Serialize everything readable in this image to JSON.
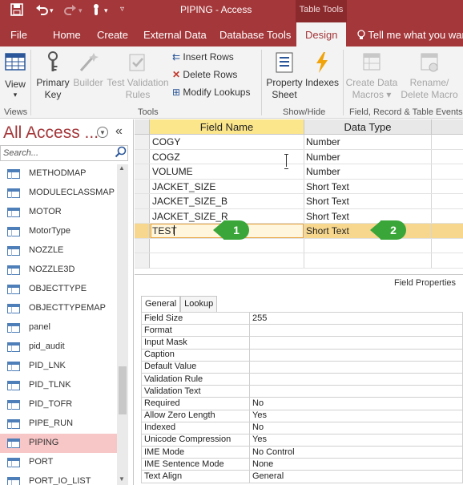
{
  "titlebar": {
    "title": "PIPING  -  Access",
    "contextual_tab_group": "Table Tools",
    "save_icon": "save-icon",
    "undo_icon": "undo-icon",
    "redo_icon": "redo-icon",
    "touch_icon": "touch-mode-icon",
    "customize_icon": "customize-qat-icon"
  },
  "tabs": [
    {
      "label": "File"
    },
    {
      "label": "Home"
    },
    {
      "label": "Create"
    },
    {
      "label": "External Data"
    },
    {
      "label": "Database Tools"
    },
    {
      "label": "Design"
    }
  ],
  "tellme": "Tell me what you want",
  "ribbon": {
    "view": {
      "label": "View",
      "arrow": "▾"
    },
    "primary_key": {
      "label1": "Primary",
      "label2": "Key"
    },
    "builder": {
      "label": "Builder"
    },
    "test_validation": {
      "label1": "Test Validation",
      "label2": "Rules"
    },
    "insert_rows": "Insert Rows",
    "delete_rows": "Delete Rows",
    "modify_lookups": "Modify Lookups",
    "property_sheet": {
      "label1": "Property",
      "label2": "Sheet"
    },
    "indexes": {
      "label": "Indexes"
    },
    "create_data_macros": {
      "label1": "Create Data",
      "label2": "Macros ▾"
    },
    "rename_delete_macro": {
      "label1": "Rename/",
      "label2": "Delete Macro"
    },
    "groups": [
      "Views",
      "Tools",
      "Show/Hide",
      "Field, Record & Table Events"
    ]
  },
  "nav": {
    "title": "All Access ...",
    "collapse": "«",
    "search_placeholder": "Search...",
    "items": [
      {
        "label": "METHODMAP"
      },
      {
        "label": "MODULECLASSMAP"
      },
      {
        "label": "MOTOR"
      },
      {
        "label": "MotorType"
      },
      {
        "label": "NOZZLE"
      },
      {
        "label": "NOZZLE3D"
      },
      {
        "label": "OBJECTTYPE"
      },
      {
        "label": "OBJECTTYPEMAP"
      },
      {
        "label": "panel"
      },
      {
        "label": "pid_audit"
      },
      {
        "label": "PID_LNK"
      },
      {
        "label": "PID_TLNK"
      },
      {
        "label": "PID_TOFR"
      },
      {
        "label": "PIPE_RUN"
      },
      {
        "label": "PIPING"
      },
      {
        "label": "PORT"
      },
      {
        "label": "PORT_IO_LIST"
      }
    ],
    "selected_index": 14
  },
  "grid": {
    "headers": {
      "field_name": "Field Name",
      "data_type": "Data Type"
    },
    "rows": [
      {
        "name": "COGY",
        "type": "Number"
      },
      {
        "name": "COGZ",
        "type": "Number"
      },
      {
        "name": "VOLUME",
        "type": "Number"
      },
      {
        "name": "JACKET_SIZE",
        "type": "Short Text"
      },
      {
        "name": "JACKET_SIZE_B",
        "type": "Short Text"
      },
      {
        "name": "JACKET_SIZE_R",
        "type": "Short Text"
      },
      {
        "name": "TEST",
        "type": "Short Text"
      },
      {
        "name": "",
        "type": ""
      },
      {
        "name": "",
        "type": ""
      }
    ],
    "current_row": 6
  },
  "callouts": [
    {
      "label": "1"
    },
    {
      "label": "2"
    }
  ],
  "properties": {
    "title": "Field Properties",
    "tabs": [
      {
        "label": "General"
      },
      {
        "label": "Lookup"
      }
    ],
    "rows": [
      {
        "key": "Field Size",
        "value": "255"
      },
      {
        "key": "Format",
        "value": ""
      },
      {
        "key": "Input Mask",
        "value": ""
      },
      {
        "key": "Caption",
        "value": ""
      },
      {
        "key": "Default Value",
        "value": ""
      },
      {
        "key": "Validation Rule",
        "value": ""
      },
      {
        "key": "Validation Text",
        "value": ""
      },
      {
        "key": "Required",
        "value": "No"
      },
      {
        "key": "Allow Zero Length",
        "value": "Yes"
      },
      {
        "key": "Indexed",
        "value": "No"
      },
      {
        "key": "Unicode Compression",
        "value": "Yes"
      },
      {
        "key": "IME Mode",
        "value": "No Control"
      },
      {
        "key": "IME Sentence Mode",
        "value": "None"
      },
      {
        "key": "Text Align",
        "value": "General"
      }
    ]
  },
  "colors": {
    "brand": "#a4373a",
    "selected_nav": "#f7c6c7",
    "current_row": "#f7d78e",
    "callout": "#3aa63a"
  }
}
